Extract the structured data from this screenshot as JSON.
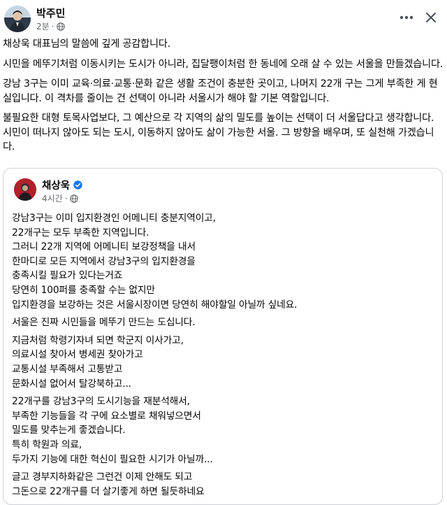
{
  "post": {
    "author": "박주민",
    "time": "2분",
    "separator": "·",
    "icons": {
      "audience": "globe-icon",
      "more": "more-horizontal-icon",
      "close": "close-icon"
    },
    "paragraphs": [
      "채상욱 대표님의 말씀에 깊게 공감합니다.",
      "시민을 메뚜기처럼 이동시키는 도시가 아니라, 집달팽이처럼 한 동네에 오래 살 수 있는 서울을 만들겠습니다.",
      "강남 3구는 이미 교육·의료·교통·문화 같은 생활 조건이 충분한 곳이고, 나머지 22개 구는 그게 부족한 게 현실입니다. 이 격차를 줄이는 건 선택이 아니라 서울시가 해야 할 기본 역할입니다.",
      "불필요한 대형 토목사업보다, 그 예산으로 각 지역의 삶의 밀도를 높이는 선택이 더 서울답다고 생각합니다. 시민이 떠나지 않아도 되는 도시, 이동하지 않아도 삶이 가능한 서울. 그 방향을 배우며, 또 실천해 가겠습니다."
    ]
  },
  "shared": {
    "author": "채상욱",
    "verified": true,
    "time": "4시간",
    "separator": "·",
    "icons": {
      "verified": "verified-badge-icon",
      "audience": "globe-icon"
    },
    "paragraphs": [
      "강남3구는 이미 입지환경인 어메니티 충분지역이고,\n22개구는 모두 부족한 지역입니다.\n그러니 22개 지역에 어메니티 보강정책을 내서\n한마디로 모든 지역에서 강남3구의 입지환경을\n충족시킬 필요가 있다는거죠\n당연히 100퍼를 충족할 수는 없지만\n입지환경을 보강하는 것은 서울시장이면 당연히 해야할일 아닐까 싶네요.",
      "서울은 진짜 시민들을 메뚜기 만드는 도십니다.",
      "지금처럼 학령기자녀 되면 학군지 이사가고,\n의료시설 찾아서 병세권 찾아가고\n교통시설 부족해서 고통받고\n문화시설 없어서 탈강북하고...",
      "22개구를 강남3구의 도시기능을 재분석해서,\n부족한 기능들을 각 구에 요소별로 채워넣으면서\n밀도를 맞추는게 좋겠습니다.\n특히 학원과 의료,\n두가지 기능에 대한 혁신이 필요한 시기가 아닐까...",
      "글고 경부지하화같은 그런건 이제 안해도 되고\n그돈으로 22개구를 더 살기좋게 하면 될듯하네요"
    ]
  }
}
